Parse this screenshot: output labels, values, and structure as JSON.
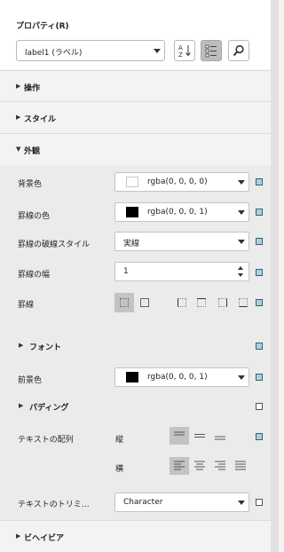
{
  "panel": {
    "title": "プロパティ(R)",
    "selected_object": "label1 (ラベル)"
  },
  "toolbar": {
    "sort_icon": "sort-az-icon",
    "categorized_icon": "categorized-icon",
    "search_icon": "search-icon"
  },
  "sections": {
    "operation": "操作",
    "style": "スタイル",
    "appearance": "外観",
    "behavior": "ビヘイビア"
  },
  "appearance": {
    "background_color": {
      "label": "背景色",
      "value": "rgba(0, 0, 0, 0)",
      "swatch": "#ffffff"
    },
    "border_color": {
      "label": "罫線の色",
      "value": "rgba(0, 0, 0, 1)",
      "swatch": "#000000"
    },
    "border_style": {
      "label": "罫線の破線スタイル",
      "value": "実線"
    },
    "border_width": {
      "label": "罫線の幅",
      "value": "1"
    },
    "borders": {
      "label": "罫線"
    },
    "font": {
      "label": "フォント"
    },
    "foreground_color": {
      "label": "前景色",
      "value": "rgba(0, 0, 0, 1)",
      "swatch": "#000000"
    },
    "padding": {
      "label": "パディング"
    },
    "text_alignment": {
      "label": "テキストの配列",
      "vertical_label": "縦",
      "horizontal_label": "横",
      "vertical_selected": "top",
      "horizontal_selected": "left"
    },
    "text_trimming": {
      "label": "テキストのトリミ…",
      "value": "Character"
    }
  },
  "colors": {
    "panel_bg": "#f3f3f3",
    "active_button": "#bcbcbc",
    "reset_indicator": "#a9d3dc"
  }
}
